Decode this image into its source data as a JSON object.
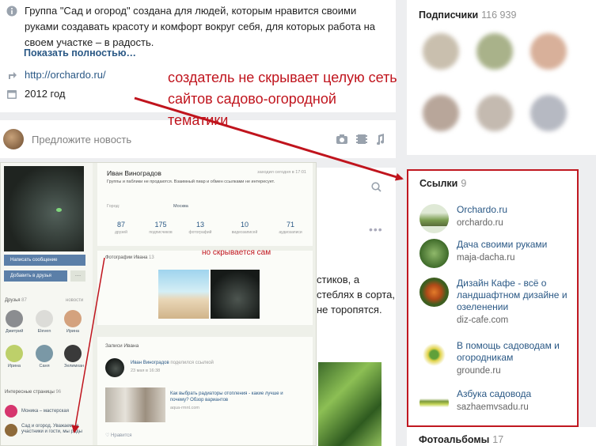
{
  "group_info": {
    "description": "Группа \"Сад и огород\" создана для людей, которым нравится своими руками создавать красоту и комфорт вокруг себя, для которых работа на своем участке – в радость.",
    "show_more": "Показать полностью…",
    "website": "http://orchardo.ru/",
    "founded": "2012 год"
  },
  "suggest": {
    "placeholder": "Предложите новость"
  },
  "annotation": "создатель не скрывает целую сеть сайтов садово-огородной тематики",
  "subscribers": {
    "label": "Подписчики",
    "count": "116 939"
  },
  "links": {
    "label": "Ссылки",
    "count": "9",
    "items": [
      {
        "title": "Orchardo.ru",
        "url": "orchardo.ru"
      },
      {
        "title": "Дача своими руками",
        "url": "maja-dacha.ru"
      },
      {
        "title": "Дизайн Кафе - всё о ландшафтном дизайне и озеленении",
        "url": "diz-cafe.com"
      },
      {
        "title": "В помощь садоводам и огородникам",
        "url": "grounde.ru"
      },
      {
        "title": "Азбука садовода",
        "url": "sazhaemvsadu.ru"
      }
    ]
  },
  "albums": {
    "label": "Фотоальбомы",
    "count": "17"
  },
  "feed_text": "стиков, а стеблях в сорта, не торопятся.",
  "profile": {
    "name": "Иван Виноградов",
    "seen": "заходил сегодня в 17:01",
    "status": "Группы и паблики не продаются. Взаимный пиар и обмен ссылками не интересует.",
    "city_label": "Город:",
    "city": "Москва",
    "stats": [
      {
        "n": "87",
        "l": "друзей"
      },
      {
        "n": "175",
        "l": "подписчиков"
      },
      {
        "n": "13",
        "l": "фотографий"
      },
      {
        "n": "10",
        "l": "видеозаписей"
      },
      {
        "n": "71",
        "l": "аудиозаписи"
      }
    ],
    "photos_label": "Фотографии Ивана",
    "photos_count": "13",
    "write_message": "Написать сообщение",
    "add_friend": "Добавить в друзья",
    "friends_label": "Друзья",
    "friends_count": "87",
    "news_label": "новости",
    "friends": [
      "Дмитрий",
      "Eleven",
      "Ирина",
      "Ирина",
      "Саня",
      "Зелимхан"
    ],
    "interesting_label": "Интересные страницы",
    "interesting_count": "96",
    "pages": [
      "Моника – мастерская",
      "Сад и огород. Уважаемые участники и гости, мы рады"
    ],
    "posts_label": "Записи Ивана",
    "post_author": "Иван Виноградов",
    "post_action": "поделился ссылкой",
    "post_time": "23 мая в 16:38",
    "post_link": "Как выбрать радиаторы отопления - какие лучше и почему? Обзор вариантов",
    "post_domain": "aqua-rmnt.com",
    "like_label": "Нравится",
    "note": "но скрывается сам"
  }
}
